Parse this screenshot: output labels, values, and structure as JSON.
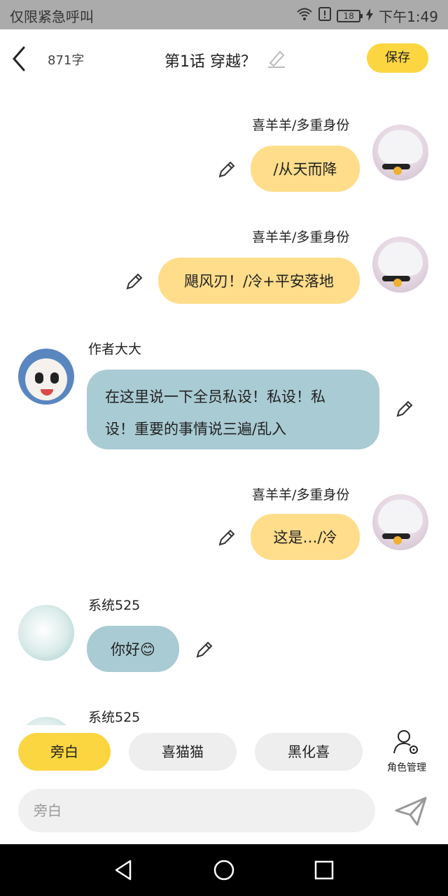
{
  "status_bar": {
    "carrier": "仅限紧急呼叫",
    "battery": "18",
    "time": "下午1:49"
  },
  "header": {
    "word_count": "871字",
    "title": "第1话  穿越？",
    "save_label": "保存"
  },
  "messages": [
    {
      "side": "right",
      "name": "喜羊羊/多重身份",
      "text": "/从天而降",
      "avatar": "anime-avatar"
    },
    {
      "side": "right",
      "name": "喜羊羊/多重身份",
      "text": "飓风刃！/冷+平安落地",
      "avatar": "anime-avatar"
    },
    {
      "side": "left",
      "name": "作者大大",
      "text_lines": [
        "在这里说一下全员私设！私设！私",
        "设！重要的事情说三遍/乱入"
      ],
      "avatar": "sheep-avatar"
    },
    {
      "side": "right",
      "name": "喜羊羊/多重身份",
      "text": "这是…/冷",
      "avatar": "anime-avatar"
    },
    {
      "side": "left",
      "name": "系统525",
      "text": "你好😊",
      "avatar": "girl-avatar"
    },
    {
      "side": "left",
      "name": "系统525",
      "avatar": "girl-avatar"
    }
  ],
  "quick_roles": [
    {
      "label": "旁白",
      "active": true
    },
    {
      "label": "喜猫猫",
      "active": false
    },
    {
      "label": "黑化喜",
      "active": false
    }
  ],
  "role_manager_label": "角色管理",
  "input": {
    "placeholder": "旁白"
  },
  "colors": {
    "accent_yellow": "#fcd640",
    "bubble_yellow": "#ffdd8b",
    "bubble_blue": "#a9cbd3"
  }
}
